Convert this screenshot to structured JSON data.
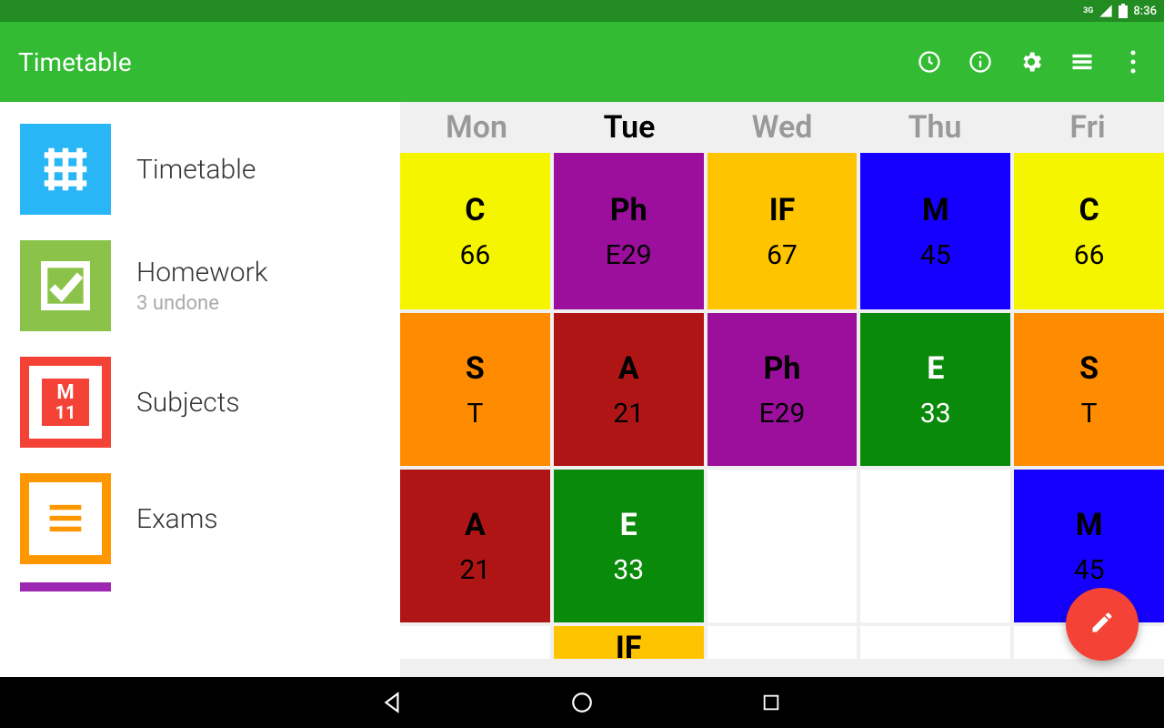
{
  "status": {
    "network": "3G",
    "time": "8:36"
  },
  "appbar": {
    "title": "Timetable",
    "actions": [
      "clock-icon",
      "info-icon",
      "gear-icon",
      "menu-icon",
      "more-icon"
    ]
  },
  "sidebar": {
    "items": [
      {
        "label": "Timetable",
        "sub": "",
        "icon": "grid-icon",
        "color": "#29b6f6"
      },
      {
        "label": "Homework",
        "sub": "3 undone",
        "icon": "check-icon",
        "color": "#8bc34a"
      },
      {
        "label": "Subjects",
        "sub": "",
        "icon": "m11-icon",
        "color": "#f44336"
      },
      {
        "label": "Exams",
        "sub": "",
        "icon": "lines-icon",
        "color": "#ff9800"
      }
    ]
  },
  "timetable": {
    "days": [
      "Mon",
      "Tue",
      "Wed",
      "Thu",
      "Fri"
    ],
    "activeDay": "Tue",
    "rows": [
      [
        {
          "code": "C",
          "room": "66",
          "bg": "#f5f500",
          "fg": "#000"
        },
        {
          "code": "Ph",
          "room": "E29",
          "bg": "#9c0f9c",
          "fg": "#000"
        },
        {
          "code": "IF",
          "room": "67",
          "bg": "#ffc400",
          "fg": "#000"
        },
        {
          "code": "M",
          "room": "45",
          "bg": "#1500ff",
          "fg": "#000"
        },
        {
          "code": "C",
          "room": "66",
          "bg": "#f5f500",
          "fg": "#000"
        }
      ],
      [
        {
          "code": "S",
          "room": "T",
          "bg": "#ff8c00",
          "fg": "#000"
        },
        {
          "code": "A",
          "room": "21",
          "bg": "#b01515",
          "fg": "#000"
        },
        {
          "code": "Ph",
          "room": "E29",
          "bg": "#9c0f9c",
          "fg": "#000"
        },
        {
          "code": "E",
          "room": "33",
          "bg": "#0a8a0a",
          "fg": "#fff"
        },
        {
          "code": "S",
          "room": "T",
          "bg": "#ff8c00",
          "fg": "#000"
        }
      ],
      [
        {
          "code": "A",
          "room": "21",
          "bg": "#b01515",
          "fg": "#000"
        },
        {
          "code": "E",
          "room": "33",
          "bg": "#0a8a0a",
          "fg": "#fff"
        },
        {
          "empty": true
        },
        {
          "empty": true
        },
        {
          "code": "M",
          "room": "45",
          "bg": "#1500ff",
          "fg": "#000"
        }
      ],
      [
        {
          "empty": true
        },
        {
          "code": "IF",
          "room": "",
          "bg": "#ffc400",
          "fg": "#000"
        },
        {
          "empty": true
        },
        {
          "empty": true
        },
        {
          "empty": true
        }
      ]
    ]
  },
  "fab": {
    "icon": "pencil-icon"
  }
}
